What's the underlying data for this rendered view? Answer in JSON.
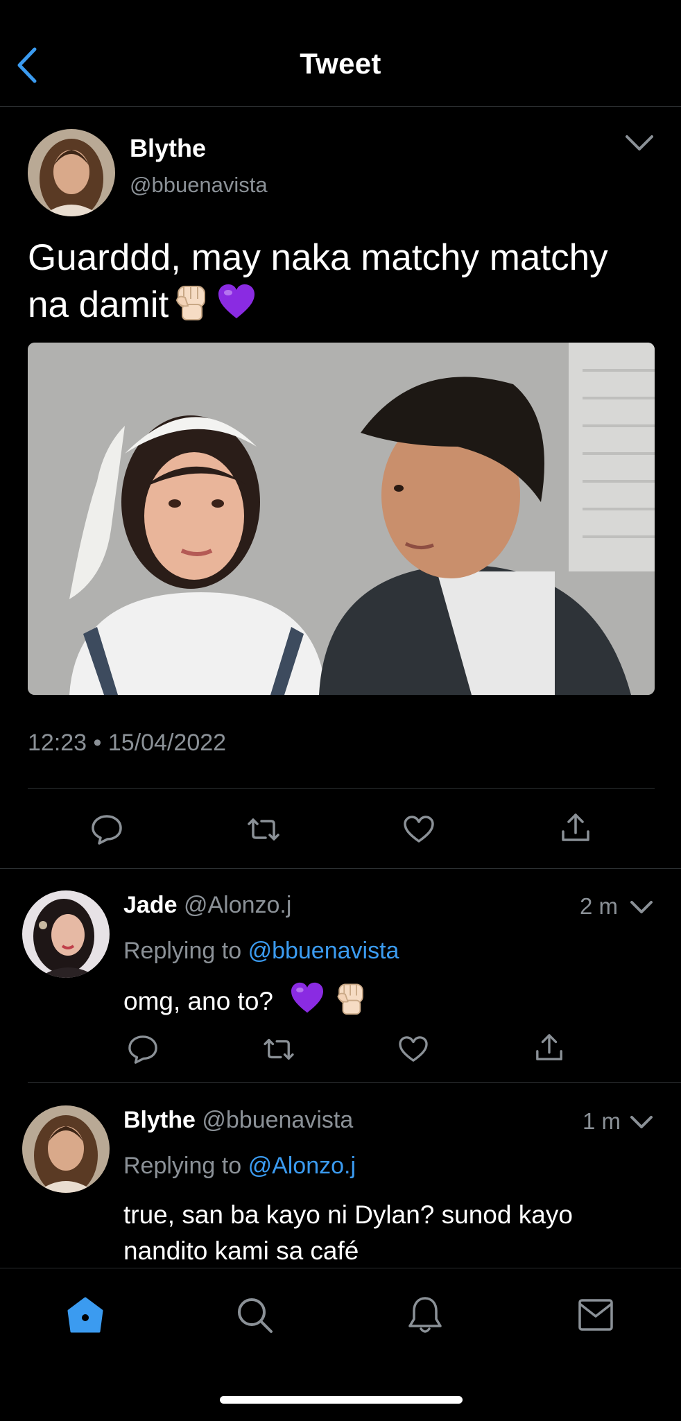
{
  "header": {
    "title": "Tweet"
  },
  "tweet": {
    "author_name": "Blythe",
    "author_handle": "@bbuenavista",
    "text_line1": "Guarddd, may naka matchy matchy",
    "text_line2": "na damit",
    "meta": "12:23 • 15/04/2022",
    "emojis": [
      "raised-fist",
      "purple-heart"
    ]
  },
  "replies": [
    {
      "name": "Jade",
      "handle": "@Alonzo.j",
      "time": "2 m",
      "replying_prefix": "Replying to",
      "replying_to": "@bbuenavista",
      "text": "omg, ano to?",
      "emojis": [
        "purple-heart",
        "raised-fist"
      ]
    },
    {
      "name": "Blythe",
      "handle": "@bbuenavista",
      "time": "1 m",
      "replying_prefix": "Replying to",
      "replying_to": "@Alonzo.j",
      "text_line1": "true, san ba kayo ni Dylan? sunod kayo",
      "text_line2": "nandito kami sa café"
    }
  ],
  "tabs": [
    "home-icon",
    "search-icon",
    "bell-icon",
    "mail-icon"
  ],
  "colors": {
    "accent": "#3b9bf0",
    "background": "#000000",
    "secondary_text": "#8b9197",
    "heart": "#8a2be2"
  }
}
